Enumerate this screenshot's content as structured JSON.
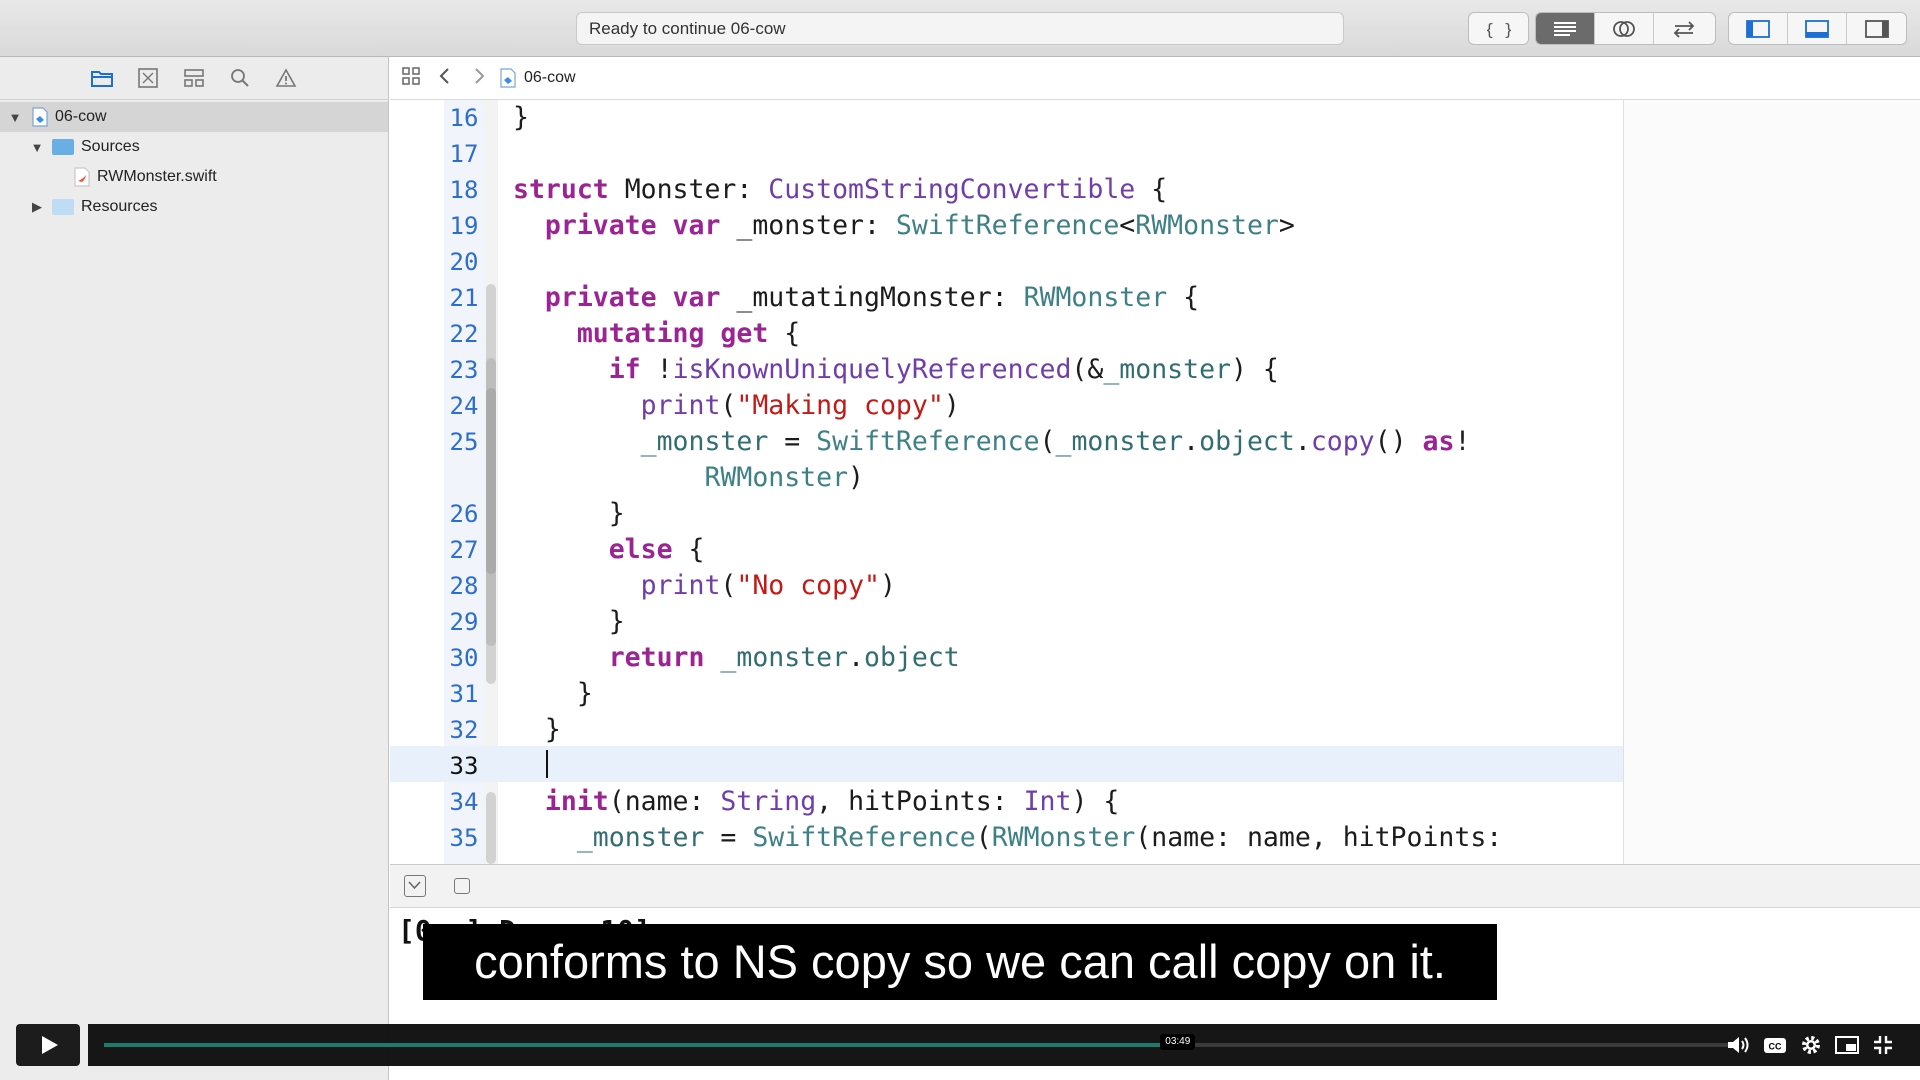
{
  "toolbar": {
    "activity_text": "Ready to continue 06-cow",
    "editor_mode_icons": [
      "braces-icon"
    ],
    "view_icons": [
      "standard-editor-icon",
      "assistant-editor-icon",
      "version-editor-icon"
    ],
    "panel_icons": [
      "left-panel-icon",
      "bottom-panel-icon",
      "right-panel-icon"
    ]
  },
  "navigator": {
    "tabs": [
      "folder-icon",
      "source-control-icon",
      "symbol-icon",
      "search-icon",
      "warning-icon"
    ],
    "tree": [
      {
        "label": "06-cow",
        "expanded": true
      },
      {
        "label": "Sources",
        "expanded": true
      },
      {
        "label": "RWMonster.swift"
      },
      {
        "label": "Resources",
        "expanded": false
      }
    ]
  },
  "jumpbar": {
    "file": "06-cow"
  },
  "editor": {
    "current_line": 33,
    "lines": [
      {
        "n": "16",
        "tokens": [
          {
            "t": "}",
            "c": "pn"
          }
        ]
      },
      {
        "n": "17",
        "tokens": []
      },
      {
        "n": "18",
        "tokens": [
          {
            "t": "struct ",
            "c": "kw"
          },
          {
            "t": "Monster: ",
            "c": "pn"
          },
          {
            "t": "CustomStringConvertible",
            "c": "ty2"
          },
          {
            "t": " {",
            "c": "pn"
          }
        ]
      },
      {
        "n": "19",
        "tokens": [
          {
            "t": "  private var ",
            "c": "kw"
          },
          {
            "t": "_monster: ",
            "c": "pn"
          },
          {
            "t": "SwiftReference",
            "c": "ty"
          },
          {
            "t": "<",
            "c": "pn"
          },
          {
            "t": "RWMonster",
            "c": "ty"
          },
          {
            "t": ">",
            "c": "pn"
          }
        ]
      },
      {
        "n": "20",
        "tokens": []
      },
      {
        "n": "21",
        "tokens": [
          {
            "t": "  private var ",
            "c": "kw"
          },
          {
            "t": "_mutatingMonster: ",
            "c": "pn"
          },
          {
            "t": "RWMonster",
            "c": "ty"
          },
          {
            "t": " {",
            "c": "pn"
          }
        ]
      },
      {
        "n": "22",
        "tokens": [
          {
            "t": "    mutating get ",
            "c": "kw"
          },
          {
            "t": "{",
            "c": "pn"
          }
        ]
      },
      {
        "n": "23",
        "tokens": [
          {
            "t": "      if ",
            "c": "kw"
          },
          {
            "t": "!",
            "c": "pn"
          },
          {
            "t": "isKnownUniquelyReferenced",
            "c": "ty2"
          },
          {
            "t": "(&",
            "c": "pn"
          },
          {
            "t": "_monster",
            "c": "fn"
          },
          {
            "t": ") {",
            "c": "pn"
          }
        ]
      },
      {
        "n": "24",
        "tokens": [
          {
            "t": "        ",
            "c": "pn"
          },
          {
            "t": "print",
            "c": "ty2"
          },
          {
            "t": "(",
            "c": "pn"
          },
          {
            "t": "\"Making copy\"",
            "c": "str"
          },
          {
            "t": ")",
            "c": "pn"
          }
        ]
      },
      {
        "n": "25",
        "tokens": [
          {
            "t": "        ",
            "c": "pn"
          },
          {
            "t": "_monster",
            "c": "fn"
          },
          {
            "t": " = ",
            "c": "pn"
          },
          {
            "t": "SwiftReference",
            "c": "ty"
          },
          {
            "t": "(",
            "c": "pn"
          },
          {
            "t": "_monster",
            "c": "fn"
          },
          {
            "t": ".",
            "c": "pn"
          },
          {
            "t": "object",
            "c": "fn"
          },
          {
            "t": ".",
            "c": "pn"
          },
          {
            "t": "copy",
            "c": "ty2"
          },
          {
            "t": "() ",
            "c": "pn"
          },
          {
            "t": "as",
            "c": "kw"
          },
          {
            "t": "!",
            "c": "pn"
          }
        ]
      },
      {
        "n": "",
        "tokens": [
          {
            "t": "            ",
            "c": "pn"
          },
          {
            "t": "RWMonster",
            "c": "ty"
          },
          {
            "t": ")",
            "c": "pn"
          }
        ]
      },
      {
        "n": "26",
        "tokens": [
          {
            "t": "      }",
            "c": "pn"
          }
        ]
      },
      {
        "n": "27",
        "tokens": [
          {
            "t": "      else ",
            "c": "kw"
          },
          {
            "t": "{",
            "c": "pn"
          }
        ]
      },
      {
        "n": "28",
        "tokens": [
          {
            "t": "        ",
            "c": "pn"
          },
          {
            "t": "print",
            "c": "ty2"
          },
          {
            "t": "(",
            "c": "pn"
          },
          {
            "t": "\"No copy\"",
            "c": "str"
          },
          {
            "t": ")",
            "c": "pn"
          }
        ]
      },
      {
        "n": "29",
        "tokens": [
          {
            "t": "      }",
            "c": "pn"
          }
        ]
      },
      {
        "n": "30",
        "tokens": [
          {
            "t": "      return ",
            "c": "kw"
          },
          {
            "t": "_monster",
            "c": "fn"
          },
          {
            "t": ".",
            "c": "pn"
          },
          {
            "t": "object",
            "c": "fn"
          }
        ]
      },
      {
        "n": "31",
        "tokens": [
          {
            "t": "    }",
            "c": "pn"
          }
        ]
      },
      {
        "n": "32",
        "tokens": [
          {
            "t": "  }",
            "c": "pn"
          }
        ]
      },
      {
        "n": "33",
        "tokens": []
      },
      {
        "n": "34",
        "tokens": [
          {
            "t": "  init",
            "c": "kw"
          },
          {
            "t": "(name: ",
            "c": "pn"
          },
          {
            "t": "String",
            "c": "ty2"
          },
          {
            "t": ", hitPoints: ",
            "c": "pn"
          },
          {
            "t": "Int",
            "c": "ty2"
          },
          {
            "t": ") {",
            "c": "pn"
          }
        ]
      },
      {
        "n": "35",
        "tokens": [
          {
            "t": "    ",
            "c": "pn"
          },
          {
            "t": "_monster",
            "c": "fn"
          },
          {
            "t": " = ",
            "c": "pn"
          },
          {
            "t": "SwiftReference",
            "c": "ty"
          },
          {
            "t": "(",
            "c": "pn"
          },
          {
            "t": "RWMonster",
            "c": "ty"
          },
          {
            "t": "(name: name, hitPoints:",
            "c": "pn"
          }
        ]
      }
    ]
  },
  "console": {
    "text": "[0..] Demo..10]"
  },
  "caption": {
    "text": "conforms to NS copy so we can call copy on it."
  },
  "player": {
    "timestamp": "03:49",
    "progress": 0.657,
    "controls": [
      "volume-icon",
      "captions-icon",
      "settings-icon",
      "pip-icon",
      "fullscreen-icon"
    ],
    "colors": {
      "progress": "#1a7a6e"
    }
  }
}
